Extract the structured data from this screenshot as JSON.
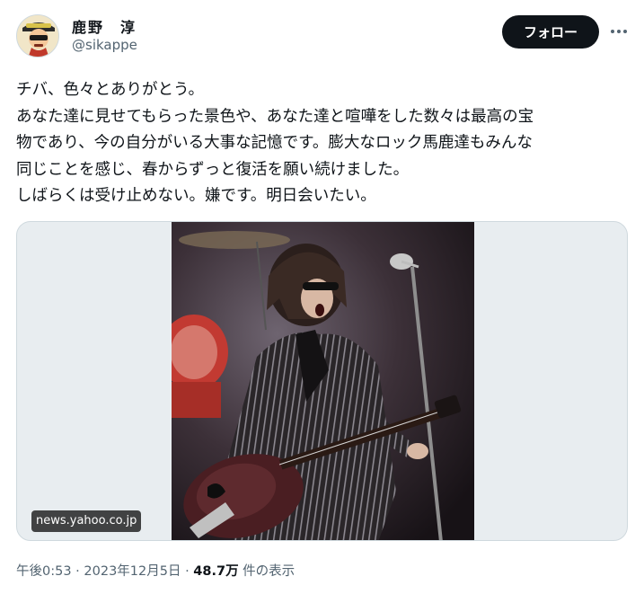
{
  "author": {
    "display_name": "鹿野　淳",
    "handle": "@sikappe",
    "avatar_icon": "avatar-illustration-icon"
  },
  "actions": {
    "follow_label": "フォロー",
    "more_icon": "more-icon"
  },
  "tweet": {
    "lines": [
      "チバ、色々とありがとう。",
      "あなた達に見せてもらった景色や、あなた達と喧嘩をした数々は最高の宝",
      "物であり、今の自分がいる大事な記憶です。膨大なロック馬鹿達もみんな",
      "同じことを感じ、春からずっと復活を願い続けました。",
      "しばらくは受け止めない。嫌です。明日会いたい。"
    ]
  },
  "media": {
    "source": "news.yahoo.co.jp"
  },
  "meta": {
    "time": "午後0:53",
    "separator": " · ",
    "date": "2023年12月5日",
    "views_count": "48.7万",
    "views_label": " 件の表示"
  },
  "colors": {
    "text": "#0f1419",
    "secondary": "#536471",
    "follow_bg": "#0f1419",
    "border": "#cfd9de"
  }
}
